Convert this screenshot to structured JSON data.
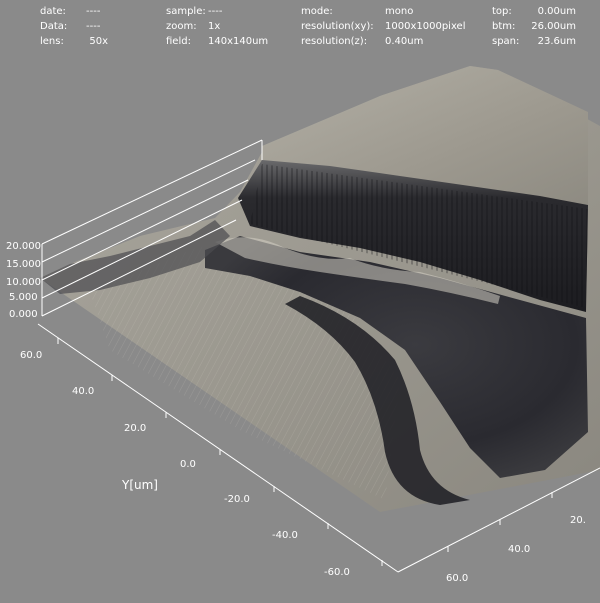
{
  "header": {
    "date_label": "date:",
    "date_value": "----",
    "data_label": "Data:",
    "data_value": "----",
    "lens_label": "lens:",
    "lens_value": "50x",
    "sample_label": "sample:",
    "sample_value": "----",
    "zoom_label": "zoom:",
    "zoom_value": "1x",
    "field_label": "field:",
    "field_value": "140x140um",
    "mode_label": "mode:",
    "mode_value": "mono",
    "res_xy_label": "resolution(xy):",
    "res_xy_value": "1000x1000pixel",
    "res_z_label": "resolution(z):",
    "res_z_value": "0.40um",
    "top_label": "top:",
    "top_value": "0.00um",
    "btm_label": "btm:",
    "btm_value": "26.00um",
    "span_label": "span:",
    "span_value": "23.6um"
  },
  "z_axis": {
    "ticks": [
      "20.000",
      "15.000",
      "10.000",
      "5.000",
      "0.000"
    ]
  },
  "y_axis": {
    "label": "Y[um]",
    "ticks": [
      "60.0",
      "40.0",
      "20.0",
      "0.0",
      "-20.0",
      "-40.0",
      "-60.0"
    ]
  },
  "x_axis": {
    "ticks": [
      "60.0",
      "40.0",
      "20."
    ]
  },
  "colors": {
    "background": "#8a8a8a",
    "surface_light": "#a7a49c",
    "surface_dark": "#242428",
    "axis": "#ffffff"
  }
}
